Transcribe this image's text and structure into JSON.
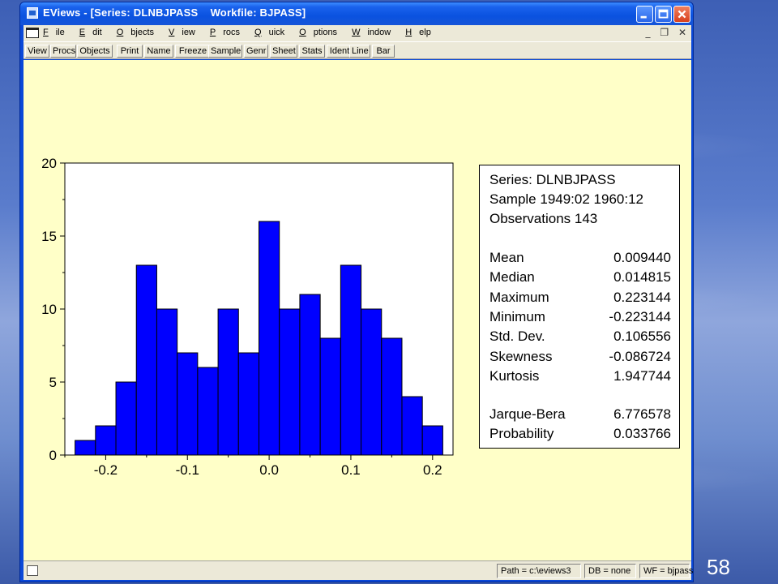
{
  "window": {
    "title": "EViews - [Series: DLNBJPASS    Workfile: BJPASS]"
  },
  "menu": {
    "items": [
      {
        "label": "File",
        "ul": "F",
        "rest": "ile"
      },
      {
        "label": "Edit",
        "ul": "E",
        "rest": "dit"
      },
      {
        "label": "Objects",
        "ul": "O",
        "rest": "bjects"
      },
      {
        "label": "View",
        "ul": "V",
        "rest": "iew"
      },
      {
        "label": "Procs",
        "ul": "P",
        "rest": "rocs"
      },
      {
        "label": "Quick",
        "ul": "Q",
        "rest": "uick"
      },
      {
        "label": "Options",
        "ul": "O",
        "rest": "ptions"
      },
      {
        "label": "Window",
        "ul": "W",
        "rest": "indow"
      },
      {
        "label": "Help",
        "ul": "H",
        "rest": "elp"
      }
    ]
  },
  "toolbar": {
    "buttons": [
      "View",
      "Procs",
      "Objects",
      "Print",
      "Name",
      "Freeze",
      "Sample",
      "Genr",
      "Sheet",
      "Stats",
      "Ident",
      "Line",
      "Bar"
    ]
  },
  "chart_data": {
    "type": "bar",
    "x_edges": [
      -0.2375,
      -0.2125,
      -0.1875,
      -0.1625,
      -0.1375,
      -0.1125,
      -0.0875,
      -0.0625,
      -0.0375,
      -0.0125,
      0.0125,
      0.0375,
      0.0625,
      0.0875,
      0.1125,
      0.1375,
      0.1625,
      0.1875,
      0.2125,
      0.2375
    ],
    "values": [
      1,
      2,
      5,
      13,
      10,
      7,
      6,
      10,
      7,
      16,
      10,
      11,
      8,
      13,
      10,
      8,
      4,
      2
    ],
    "bar_color": "#0000ff",
    "xlim": [
      -0.25,
      0.225
    ],
    "ylim": [
      0,
      20
    ],
    "x_ticks": [
      -0.2,
      -0.1,
      0.0,
      0.1,
      0.2
    ],
    "x_tick_labels": [
      "-0.2",
      "-0.1",
      "0.0",
      "0.1",
      "0.2"
    ],
    "y_ticks": [
      0,
      5,
      10,
      15,
      20
    ],
    "y_tick_labels": [
      "0",
      "5",
      "10",
      "15",
      "20"
    ],
    "grid": false
  },
  "stats": {
    "series_line": "Series: DLNBJPASS",
    "sample_line": "Sample 1949:02 1960:12",
    "obs_line": "Observations 143",
    "rows": [
      {
        "label": "Mean",
        "value": "0.009440"
      },
      {
        "label": "Median",
        "value": "0.014815"
      },
      {
        "label": "Maximum",
        "value": "0.223144"
      },
      {
        "label": "Minimum",
        "value": "-0.223144"
      },
      {
        "label": "Std. Dev.",
        "value": "0.106556"
      },
      {
        "label": "Skewness",
        "value": "-0.086724"
      },
      {
        "label": "Kurtosis",
        "value": "1.947744"
      }
    ],
    "jb_rows": [
      {
        "label": "Jarque-Bera",
        "value": "6.776578"
      },
      {
        "label": "Probability",
        "value": "0.033766"
      }
    ]
  },
  "status": {
    "path": "Path = c:\\eviews3",
    "db": "DB = none",
    "wf": "WF = bjpass"
  },
  "slide": {
    "number": "58"
  }
}
